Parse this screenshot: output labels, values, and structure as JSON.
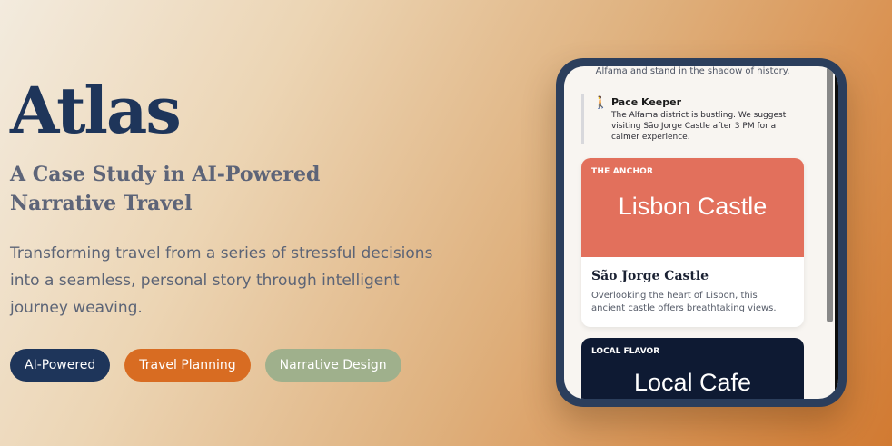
{
  "hero": {
    "title": "Atlas",
    "subtitle": "A Case Study in AI-Powered Narrative Travel",
    "description": "Transforming travel from a series of stressful decisions into a seamless, personal story through intelligent journey weaving."
  },
  "tags": [
    {
      "label": "AI-Powered",
      "color": "#1e355a"
    },
    {
      "label": "Travel Planning",
      "color": "#d86c22"
    },
    {
      "label": "Narrative Design",
      "color": "#9fb08c"
    }
  ],
  "phone": {
    "history_text": "Alfama and stand in the shadow of history.",
    "pace_keeper": {
      "icon": "walking-person-icon",
      "title": "Pace Keeper",
      "body": "The Alfama district is bustling. We suggest visiting São Jorge Castle after 3 PM for a calmer experience."
    },
    "anchor_card": {
      "eyebrow": "THE ANCHOR",
      "hero": "Lisbon Castle",
      "title": "São Jorge Castle",
      "text": "Overlooking the heart of Lisbon, this ancient castle offers breathtaking views.",
      "color": "#e2705c"
    },
    "flavor_card": {
      "eyebrow": "LOCAL FLAVOR",
      "hero": "Local Cafe",
      "color": "#0e1a33"
    }
  }
}
